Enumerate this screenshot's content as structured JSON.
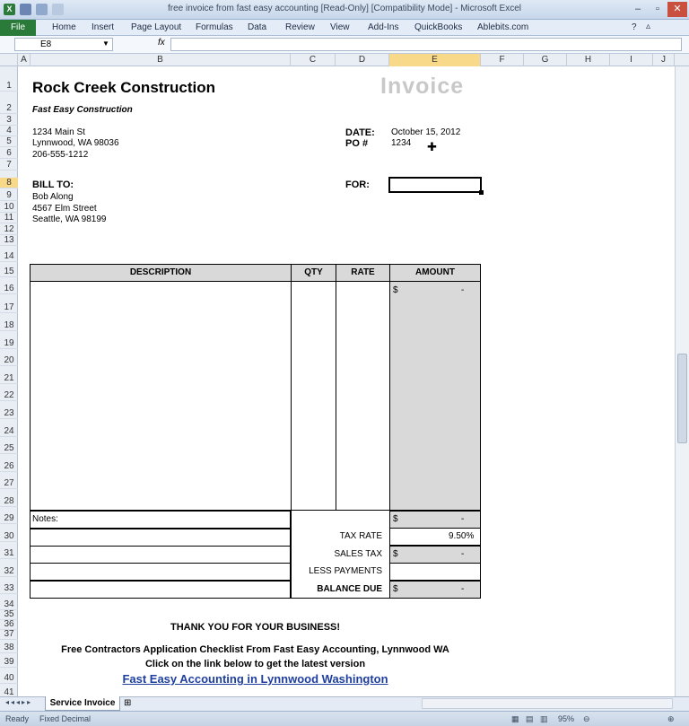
{
  "window": {
    "title": "free invoice from fast easy accounting  [Read-Only]  [Compatibility Mode]  -  Microsoft Excel"
  },
  "ribbon": {
    "file": "File",
    "tabs": [
      "Home",
      "Insert",
      "Page Layout",
      "Formulas",
      "Data",
      "Review",
      "View",
      "Add-Ins",
      "QuickBooks",
      "Ablebits.com"
    ]
  },
  "formula_bar": {
    "cell_ref": "E8",
    "fx": "fx",
    "content": ""
  },
  "columns": [
    "A",
    "B",
    "C",
    "D",
    "E",
    "F",
    "G",
    "H",
    "I",
    "J"
  ],
  "rows": [
    "1",
    "2",
    "3",
    "4",
    "5",
    "6",
    "7",
    "8",
    "9",
    "10",
    "11",
    "12",
    "13",
    "14",
    "15",
    "16",
    "17",
    "18",
    "19",
    "20",
    "21",
    "22",
    "23",
    "24",
    "25",
    "26",
    "27",
    "28",
    "29",
    "30",
    "31",
    "32",
    "33",
    "34",
    "35",
    "36",
    "37",
    "38",
    "39",
    "40",
    "41"
  ],
  "invoice": {
    "company": "Rock Creek Construction",
    "slogan": "Fast Easy Construction",
    "title": "Invoice",
    "address1": "1234 Main St",
    "address2": "Lynnwood, WA 98036",
    "phone": "206-555-1212",
    "date_label": "DATE:",
    "date_value": "October 15, 2012",
    "po_label": "PO #",
    "po_value": "1234",
    "bill_to_label": "BILL TO:",
    "bill_name": "Bob Along",
    "bill_street": "4567 Elm Street",
    "bill_city": "Seattle, WA 98199",
    "for_label": "FOR:",
    "headers": {
      "description": "DESCRIPTION",
      "qty": "QTY",
      "rate": "RATE",
      "amount": "AMOUNT"
    },
    "amount_currency": "$",
    "amount_value": "-",
    "notes_label": "Notes:",
    "subtotal_currency": "$",
    "subtotal_value": "-",
    "tax_rate_label": "TAX RATE",
    "tax_rate_value": "9.50%",
    "sales_tax_label": "SALES TAX",
    "sales_tax_currency": "$",
    "sales_tax_value": "-",
    "less_payments_label": "LESS PAYMENTS",
    "balance_due_label": "BALANCE DUE",
    "balance_currency": "$",
    "balance_value": "-",
    "thank_you": "THANK YOU FOR YOUR BUSINESS!",
    "promo1": "Free Contractors Application Checklist From Fast Easy Accounting, Lynnwood WA",
    "promo2": "Click on the link below to get the latest version",
    "link": "Fast Easy Accounting in Lynnwood Washington"
  },
  "sheet_tabs": {
    "active": "Service Invoice"
  },
  "status": {
    "left": "Ready",
    "mode": "Fixed Decimal",
    "zoom": "95%"
  },
  "colors": {
    "header_fill": "#d9d9d9",
    "excel_green": "#2a7a3a",
    "link": "#1f3f9f",
    "selection": "#f8d98a"
  }
}
